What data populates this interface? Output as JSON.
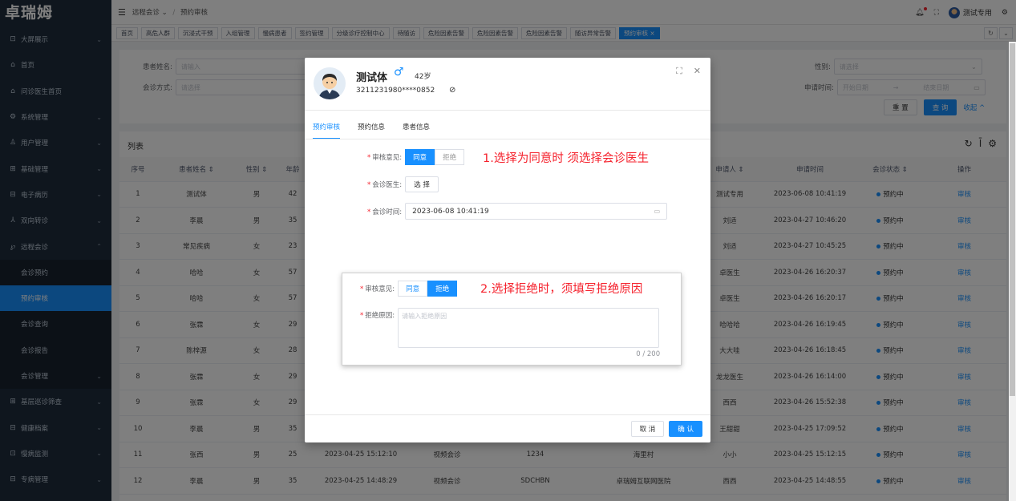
{
  "app": {
    "logo": "卓瑞姆"
  },
  "sidebar": {
    "items": [
      {
        "icon": "⊡",
        "label": "大屏展示",
        "chev": "⌄"
      },
      {
        "icon": "⌂",
        "label": "首页",
        "chev": ""
      },
      {
        "icon": "⌂",
        "label": "问诊医生首页",
        "chev": ""
      },
      {
        "icon": "⚙",
        "label": "系统管理",
        "chev": "⌄"
      },
      {
        "icon": "♙",
        "label": "用户管理",
        "chev": "⌄"
      },
      {
        "icon": "⊞",
        "label": "基础管理",
        "chev": "⌄"
      },
      {
        "icon": "⊟",
        "label": "电子病历",
        "chev": "⌄"
      },
      {
        "icon": "⅄",
        "label": "双向转诊",
        "chev": "⌄"
      },
      {
        "icon": "℘",
        "label": "远程会诊",
        "chev": "⌃"
      }
    ],
    "subitems": [
      {
        "label": "会诊预约"
      },
      {
        "label": "预约审核"
      },
      {
        "label": "会诊查询"
      },
      {
        "label": "会诊报告"
      },
      {
        "label": "会诊管理",
        "chev": "⌄"
      }
    ],
    "bottom_items": [
      {
        "icon": "⊞",
        "label": "基层巡诊筛查",
        "chev": "⌄"
      },
      {
        "icon": "⊟",
        "label": "健康档案",
        "chev": "⌄"
      },
      {
        "icon": "⊡",
        "label": "慢病监测",
        "chev": "⌄"
      },
      {
        "icon": "⊟",
        "label": "专病管理",
        "chev": "⌄"
      }
    ]
  },
  "topbar": {
    "breadcrumb_1": "远程会诊",
    "breadcrumb_1_chev": "⌄",
    "sep": "/",
    "breadcrumb_2": "预约审核",
    "user": "测试专用"
  },
  "tabs": [
    "首页",
    "高危人群",
    "沉浸式干预",
    "入组管理",
    "慢病患者",
    "签约管理",
    "分级诊疗控制中心",
    "待随访",
    "危险因素告警",
    "危险因素告警",
    "危险因素告警",
    "随访异常告警",
    "预约审核 ×"
  ],
  "search": {
    "patient_name_label": "患者姓名:",
    "patient_name_placeholder": "请输入",
    "mode_label": "会诊方式:",
    "mode_placeholder": "请选择",
    "gender_label": "性别:",
    "gender_placeholder": "请选择",
    "apply_time_label": "申请时间:",
    "start_placeholder": "开始日期",
    "arrow": "→",
    "end_placeholder": "结束日期",
    "reset": "重 置",
    "query": "查 询",
    "collapse": "收起 ^"
  },
  "list": {
    "title": "列表",
    "headers": {
      "index": "序号",
      "name": "患者姓名 ⇕",
      "gender": "性别 ⇕",
      "age": "年龄",
      "time": "",
      "mode": "",
      "code": "",
      "org": "",
      "applicant": "申请人 ⇕",
      "apply_time": "申请时间",
      "status": "会诊状态 ⇕",
      "op": "操作"
    },
    "rows": [
      {
        "i": "1",
        "name": "测试体",
        "g": "男",
        "age": "42",
        "t": "",
        "m": "",
        "c": "",
        "o": "",
        "a": "测试专用",
        "at": "2023-06-08 10:41:19",
        "s": "预约中",
        "op": "审核"
      },
      {
        "i": "2",
        "name": "李晨",
        "g": "男",
        "age": "35",
        "t": "",
        "m": "",
        "c": "",
        "o": "",
        "a": "刘适",
        "at": "2023-04-27 10:46:20",
        "s": "预约中",
        "op": "审核"
      },
      {
        "i": "3",
        "name": "常见疾病",
        "g": "女",
        "age": "23",
        "t": "",
        "m": "",
        "c": "",
        "o": "",
        "a": "刘适",
        "at": "2023-04-27 10:45:25",
        "s": "预约中",
        "op": "审核"
      },
      {
        "i": "4",
        "name": "哈哈",
        "g": "女",
        "age": "57",
        "t": "",
        "m": "",
        "c": "",
        "o": "",
        "a": "卓医生",
        "at": "2023-04-26 16:20:37",
        "s": "预约中",
        "op": "审核"
      },
      {
        "i": "5",
        "name": "哈哈",
        "g": "女",
        "age": "57",
        "t": "",
        "m": "",
        "c": "",
        "o": "",
        "a": "卓医生",
        "at": "2023-04-26 16:20:17",
        "s": "预约中",
        "op": "审核"
      },
      {
        "i": "6",
        "name": "张霖",
        "g": "女",
        "age": "29",
        "t": "",
        "m": "",
        "c": "",
        "o": "",
        "a": "哈哈哈",
        "at": "2023-04-26 16:19:45",
        "s": "预约中",
        "op": "审核"
      },
      {
        "i": "7",
        "name": "陈梓源",
        "g": "女",
        "age": "28",
        "t": "",
        "m": "",
        "c": "",
        "o": "",
        "a": "大大哇",
        "at": "2023-04-26 16:18:45",
        "s": "预约中",
        "op": "审核"
      },
      {
        "i": "8",
        "name": "张霖",
        "g": "女",
        "age": "29",
        "t": "",
        "m": "",
        "c": "",
        "o": "",
        "a": "龙龙医生",
        "at": "2023-04-26 16:14:00",
        "s": "预约中",
        "op": "审核"
      },
      {
        "i": "9",
        "name": "张霖",
        "g": "女",
        "age": "29",
        "t": "",
        "m": "",
        "c": "",
        "o": "",
        "a": "西西",
        "at": "2023-04-26 15:52:38",
        "s": "预约中",
        "op": "审核"
      },
      {
        "i": "10",
        "name": "李晨",
        "g": "男",
        "age": "35",
        "t": "",
        "m": "",
        "c": "",
        "o": "",
        "a": "王甜甜",
        "at": "2023-04-25 17:09:52",
        "s": "预约中",
        "op": "审核"
      },
      {
        "i": "11",
        "name": "张西",
        "g": "男",
        "age": "25",
        "t": "2023-04-25 15:12:10",
        "m": "视频会诊",
        "c": "1234",
        "o": "海里村",
        "a": "小小",
        "at": "2023-04-25 15:12:15",
        "s": "预约中",
        "op": "审核"
      },
      {
        "i": "12",
        "name": "李晨",
        "g": "男",
        "age": "35",
        "t": "2023-04-25 14:48:29",
        "m": "视频会诊",
        "c": "SDCHBN",
        "o": "卓瑞姆互联网医院",
        "a": "西西",
        "at": "2023-04-25 14:48:55",
        "s": "预约中",
        "op": "审核"
      }
    ]
  },
  "modal": {
    "name": "测试体",
    "gender_icon": "♂",
    "age": "42岁",
    "id_masked": "3211231980****0852",
    "tabs": [
      "预约审核",
      "预约信息",
      "患者信息"
    ],
    "opinion_label": "审核意见:",
    "agree": "同意",
    "reject": "拒绝",
    "doctor_label": "会诊医生:",
    "select_btn": "选 择",
    "time_label": "会诊时间:",
    "time_value": "2023-06-08 10:41:19",
    "note1": "1.选择为同意时 须选择会诊医生",
    "reason_label": "拒绝原因:",
    "reason_placeholder": "请输入拒绝原因",
    "counter": "0 / 200",
    "note2": "2.选择拒绝时，须填写拒绝原因",
    "cancel": "取 消",
    "confirm": "确 认"
  }
}
